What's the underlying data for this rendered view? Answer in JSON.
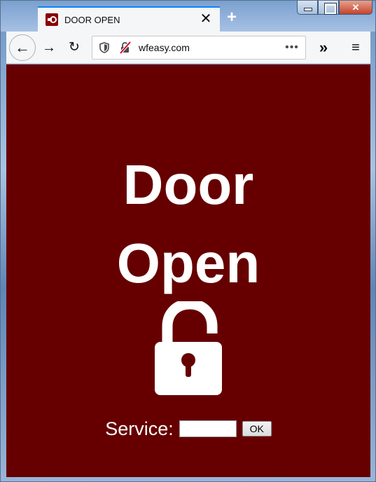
{
  "browser": {
    "tab_title": "DOOR OPEN",
    "tab_close_glyph": "✕",
    "new_tab_glyph": "+",
    "url": "wfeasy.com",
    "page_actions_glyph": "•••",
    "back_glyph": "←",
    "forward_glyph": "→",
    "reload_glyph": "↻",
    "overflow_glyph": "»",
    "menu_glyph": "≡"
  },
  "icons": {
    "favicon": "door-key-icon",
    "shield": "tracking-protection-shield-icon",
    "insecure": "insecure-lock-slash-icon",
    "padlock": "unlocked-padlock-icon"
  },
  "page": {
    "headline_line1": "Door",
    "headline_line2": "Open",
    "service_label": "Service:",
    "service_value": "",
    "ok_label": "OK"
  },
  "colors": {
    "page_background": "#660000",
    "text": "#ffffff",
    "tab_accent": "#0a84ff"
  }
}
